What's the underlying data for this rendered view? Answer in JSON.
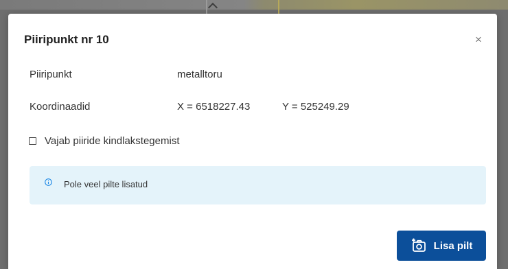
{
  "dialog": {
    "title": "Piiripunkt nr 10",
    "close_icon": "close-icon"
  },
  "fields": {
    "point_label": "Piiripunkt",
    "point_value": "metalltoru",
    "coords_label": "Koordinaadid",
    "coord_x": "X = 6518227.43",
    "coord_y": "Y = 525249.29"
  },
  "checkbox": {
    "label": "Vajab piiride kindlakstegemist",
    "checked": false
  },
  "info": {
    "icon": "info-circle-icon",
    "message": "Pole veel pilte lisatud"
  },
  "actions": {
    "add_photo_label": "Lisa pilt",
    "add_photo_icon": "add-photo-camera-icon"
  },
  "colors": {
    "primary_button": "#0c4f9a",
    "info_background": "#e4f3fa",
    "info_icon": "#1e88e5"
  }
}
